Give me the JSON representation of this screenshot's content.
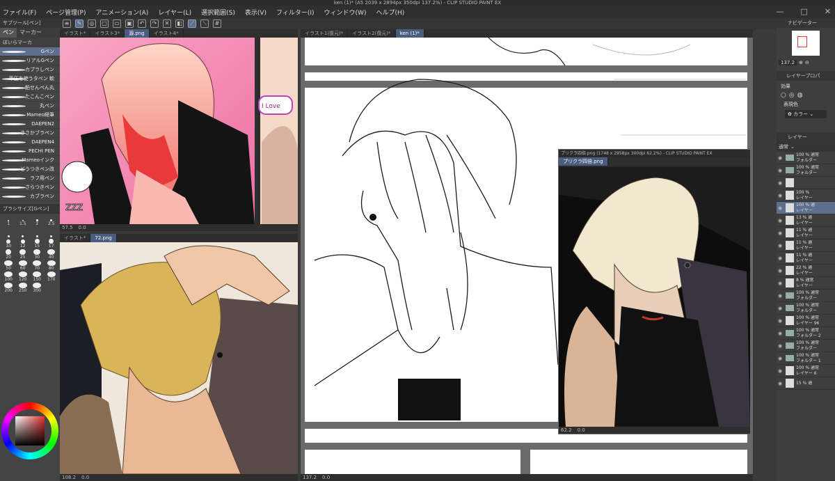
{
  "app": {
    "title": "ken (1)* (A5 2039 x 2894px 350dpi 137.2%) - CLIP STUDIO PAINT EX"
  },
  "menu": [
    "ファイル(F)",
    "ページ管理(P)",
    "アニメーション(A)",
    "レイヤー(L)",
    "選択範囲(S)",
    "表示(V)",
    "フィルター(I)",
    "ウィンドウ(W)",
    "ヘルプ(H)"
  ],
  "window_controls": {
    "minimize": "—",
    "maximize": "□",
    "close": "✕"
  },
  "tool_panel": {
    "subtool_header": "サブツール[ペン]",
    "tabs": [
      "ペン",
      "マーカー"
    ],
    "subtab": "ぼいらマーカ",
    "brushes": [
      "Gペン",
      "リアルGペン",
      "カブラしペン",
      "筆圧を使うタペン 軟",
      "鉛せんぺん丸",
      "たこんこペン",
      "丸ペン",
      "Mameo経筆",
      "DAEPEN2",
      "ささかブラペン",
      "DAEPEN4",
      "PECHI PEN",
      "Mameoインク",
      "どうつきペン改",
      "ラフ用ペン",
      "さらつきペン",
      "カブラペン"
    ],
    "selected_brush_index": 0,
    "brush_size_header": "ブラシサイズ[Gペン]",
    "brush_sizes": [
      "1",
      "1.5",
      "2",
      "2.5",
      "",
      "",
      "",
      "",
      "10",
      "12",
      "15",
      "17",
      "20",
      "25",
      "30",
      "40",
      "50",
      "60",
      "70",
      "80",
      "100",
      "120",
      "150",
      "170",
      "200",
      "250",
      "300"
    ]
  },
  "doc_windows": {
    "a": {
      "tabs": [
        "イラスト*",
        "イラスト3*",
        "源.png",
        "イラスト4*"
      ],
      "active_tab": 2,
      "zoom": "57.5",
      "angle": "0.0"
    },
    "b": {
      "tabs": [
        "イラスト*",
        "72.png"
      ],
      "active_tab": 1,
      "zoom": "108.2",
      "angle": "0.0"
    },
    "c": {
      "tabs": [
        "イラスト1(復元)*",
        "イラスト2(復元)*",
        "ken (1)*"
      ],
      "active_tab": 2,
      "zoom": "137.2",
      "angle": "0.0"
    },
    "d": {
      "title": "プリクラ四倍.png (1748 x 2958px 300dpi 62.2%) - CLIP STUDIO PAINT EX",
      "tab": "プリクラ四倍.png",
      "zoom": "62.2",
      "angle": "0.0"
    }
  },
  "speech_text": "I Love",
  "right_panel": {
    "navigator_label": "ナビゲーター",
    "zoom_value": "137.2",
    "layer_property_label": "レイヤープロパ",
    "effect_label": "効果",
    "expression_label": "表現色",
    "expression_value": "カラー",
    "layer_label": "レイヤー",
    "blend_mode": "通常",
    "layers": [
      {
        "line1": "100 % 通常",
        "line2": "フォルダー",
        "kind": "folder",
        "selected": false
      },
      {
        "line1": "100 % 通常",
        "line2": "フォルダー",
        "kind": "folder",
        "selected": false
      },
      {
        "line1": "",
        "line2": "",
        "kind": "mask",
        "selected": false
      },
      {
        "line1": "100 %",
        "line2": "レイヤー",
        "kind": "layer",
        "selected": false
      },
      {
        "line1": "100 % 通",
        "line2": "レイヤー",
        "kind": "layer",
        "selected": true
      },
      {
        "line1": "13 % 通",
        "line2": "レイヤー",
        "kind": "layer",
        "selected": false
      },
      {
        "line1": "11 % 通",
        "line2": "レイヤー",
        "kind": "layer",
        "selected": false
      },
      {
        "line1": "11 % 通",
        "line2": "レイヤー",
        "kind": "layer",
        "selected": false
      },
      {
        "line1": "11 % 通",
        "line2": "レイヤー",
        "kind": "layer",
        "selected": false
      },
      {
        "line1": "22 % 通",
        "line2": "レイヤー",
        "kind": "layer",
        "selected": false
      },
      {
        "line1": "8 % 通常",
        "line2": "レイヤー",
        "kind": "layer",
        "selected": false
      },
      {
        "line1": "100 % 通常",
        "line2": "フォルダー",
        "kind": "folder",
        "selected": false
      },
      {
        "line1": "100 % 通常",
        "line2": "フォルダー",
        "kind": "folder",
        "selected": false
      },
      {
        "line1": "100 % 通常",
        "line2": "レイヤー 96",
        "kind": "layer",
        "selected": false
      },
      {
        "line1": "100 % 通常",
        "line2": "フォルダー 2",
        "kind": "folder",
        "selected": false
      },
      {
        "line1": "100 % 通常",
        "line2": "フォルダー",
        "kind": "folder",
        "selected": false
      },
      {
        "line1": "100 % 通常",
        "line2": "フォルダー 1",
        "kind": "folder",
        "selected": false
      },
      {
        "line1": "100 % 通常",
        "line2": "レイヤー 6",
        "kind": "layer",
        "selected": false
      },
      {
        "line1": "15 % 通",
        "line2": "",
        "kind": "layer",
        "selected": false
      }
    ]
  }
}
